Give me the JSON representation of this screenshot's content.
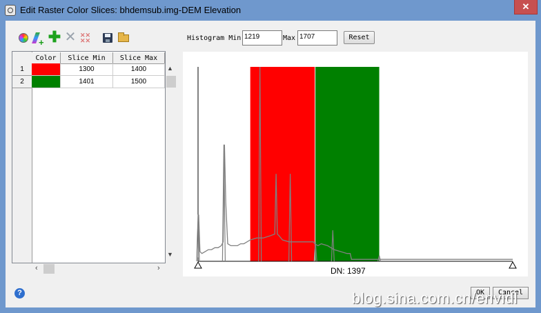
{
  "window": {
    "title": "Edit Raster Color Slices: bhdemsub.img-DEM Elevation",
    "close_glyph": "✕"
  },
  "toolbar": [
    {
      "icon": "color-wheel-icon"
    },
    {
      "icon": "gradient-icon"
    },
    {
      "icon": "add-icon",
      "glyph": "✚"
    },
    {
      "icon": "delete-icon",
      "glyph": "✕"
    },
    {
      "icon": "delete-all-icon"
    },
    {
      "icon": "save-icon"
    },
    {
      "icon": "open-folder-icon"
    }
  ],
  "table": {
    "columns": [
      "Color",
      "Slice Min",
      "Slice Max"
    ],
    "rows": [
      {
        "num": "1",
        "color": "#ff0000",
        "min": "1300",
        "max": "1400"
      },
      {
        "num": "2",
        "color": "#008000",
        "min": "1401",
        "max": "1500"
      }
    ]
  },
  "histogram": {
    "min_label": "Histogram Min",
    "min_value": "1219",
    "max_label": "Max",
    "max_value": "1707",
    "reset_label": "Reset",
    "dn_readout": "DN: 1397"
  },
  "chart_data": {
    "type": "area",
    "x_range": [
      1219,
      1707
    ],
    "slices": [
      {
        "min": 1300,
        "max": 1400,
        "color": "#ff0000"
      },
      {
        "min": 1401,
        "max": 1500,
        "color": "#008000"
      }
    ],
    "x": [
      1219,
      1220,
      1222,
      1225,
      1230,
      1235,
      1240,
      1245,
      1250,
      1255,
      1258,
      1260,
      1262,
      1265,
      1270,
      1275,
      1280,
      1285,
      1290,
      1295,
      1300,
      1310,
      1320,
      1330,
      1338,
      1340,
      1342,
      1345,
      1350,
      1360,
      1370,
      1380,
      1390,
      1396,
      1398,
      1400,
      1405,
      1410,
      1420,
      1430,
      1440,
      1450,
      1455,
      1457,
      1459,
      1461,
      1465,
      1470,
      1480,
      1490,
      1500,
      1510,
      1520,
      1526,
      1528,
      1530,
      1535,
      1540,
      1560,
      1580,
      1600,
      1620,
      1640,
      1660,
      1680,
      1700,
      1707
    ],
    "y": [
      2,
      24,
      5,
      4,
      5,
      6,
      6,
      7,
      7,
      8,
      10,
      60,
      30,
      9,
      8,
      8,
      8,
      9,
      9,
      10,
      11,
      12,
      12,
      13,
      14,
      45,
      14,
      13,
      11,
      10,
      10,
      10,
      10,
      10,
      10,
      9,
      8,
      9,
      8,
      6,
      5,
      4,
      4,
      1,
      1,
      1,
      1,
      1,
      1,
      1,
      1,
      1,
      1,
      1,
      1,
      1,
      1,
      1,
      1,
      1,
      1,
      1,
      1,
      1,
      1,
      1,
      1
    ],
    "peaks": [
      {
        "x": 1219,
        "y": 24
      },
      {
        "x": 1259,
        "y": 60
      },
      {
        "x": 1315,
        "y": 100
      },
      {
        "x": 1362,
        "y": 45
      },
      {
        "x": 1401,
        "y": 10
      },
      {
        "x": 1428,
        "y": 16
      },
      {
        "x": 1500,
        "y": 3
      }
    ],
    "ylim": [
      0,
      100
    ]
  },
  "footer": {
    "help_glyph": "?",
    "ok_label": "OK",
    "cancel_label": "Cancel",
    "watermark": "blog.sina.com.cn/envidl"
  }
}
